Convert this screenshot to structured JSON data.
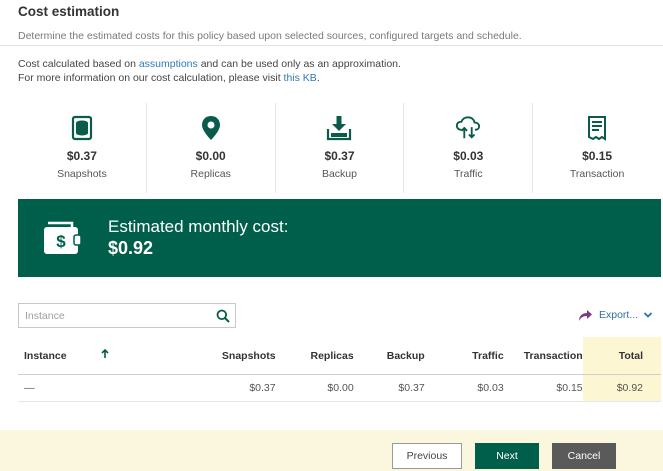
{
  "header": {
    "title": "Cost estimation",
    "subtitle": "Determine the estimated costs for this policy based upon selected sources, configured targets and schedule."
  },
  "note": {
    "line1_prefix": "Cost calculated based on ",
    "assumptions_link": "assumptions",
    "line1_suffix": " and can be used only as an approximation.",
    "line2_prefix": "For more information on our cost calculation, please visit ",
    "kb_link": "this KB",
    "line2_suffix": "."
  },
  "tiles": [
    {
      "icon": "database-icon",
      "amount": "$0.37",
      "label": "Snapshots"
    },
    {
      "icon": "location-pin-icon",
      "amount": "$0.00",
      "label": "Replicas"
    },
    {
      "icon": "backup-download-icon",
      "amount": "$0.37",
      "label": "Backup"
    },
    {
      "icon": "cloud-transfer-icon",
      "amount": "$0.03",
      "label": "Traffic"
    },
    {
      "icon": "receipt-icon",
      "amount": "$0.15",
      "label": "Transaction"
    }
  ],
  "banner": {
    "icon": "wallet-icon",
    "label": "Estimated monthly cost:",
    "value": "$0.92"
  },
  "search": {
    "placeholder": "Instance",
    "icon": "search-icon"
  },
  "export": {
    "label": "Export...",
    "icon": "share-arrow-icon"
  },
  "table": {
    "columns": [
      "Instance",
      "Snapshots",
      "Replicas",
      "Backup",
      "Traffic",
      "Transaction",
      "Total"
    ],
    "sort_icon": "arrow-up-icon",
    "rows": [
      {
        "instance": "—",
        "snapshots": "$0.37",
        "replicas": "$0.00",
        "backup": "$0.37",
        "traffic": "$0.03",
        "transaction": "$0.15",
        "total": "$0.92"
      }
    ]
  },
  "footer": {
    "previous": "Previous",
    "next": "Next",
    "cancel": "Cancel"
  },
  "colors": {
    "brand_green": "#005f4b",
    "accent_icon": "#0b5b4a",
    "link": "#2f7ab8",
    "total_highlight": "#fdf6d3",
    "footer_bg": "#fbf7df",
    "export_icon": "#7b3a8c"
  }
}
